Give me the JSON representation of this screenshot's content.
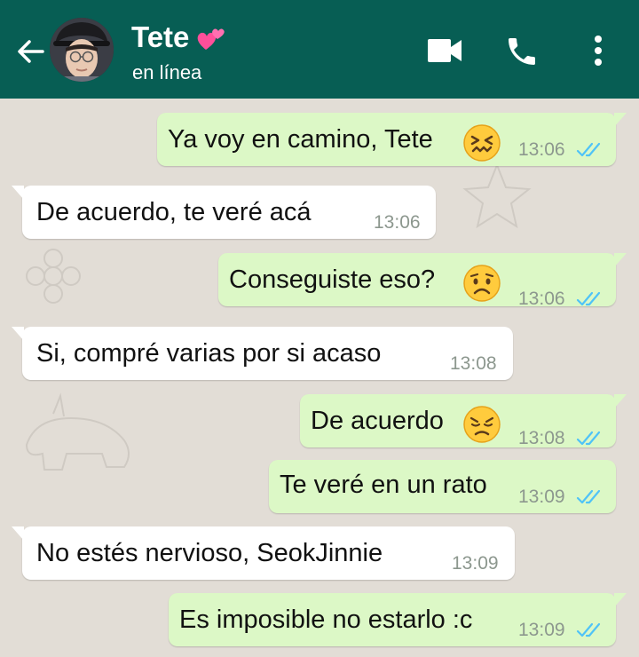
{
  "header": {
    "contact_name": "Tete",
    "status": "en línea"
  },
  "messages": [
    {
      "text": "Ya voy en camino, Tete",
      "time": "13:06"
    },
    {
      "text": "De acuerdo, te veré acá",
      "time": "13:06"
    },
    {
      "text": "Conseguiste eso?",
      "time": "13:06"
    },
    {
      "text": "Si, compré varias por si acaso",
      "time": "13:08"
    },
    {
      "text": "De acuerdo",
      "time": "13:08"
    },
    {
      "text": "Te veré en un rato",
      "time": "13:09"
    },
    {
      "text": "No estés nervioso, SeokJinnie",
      "time": "13:09"
    },
    {
      "text": "Es imposible no estarlo :c",
      "time": "13:09"
    }
  ],
  "colors": {
    "header": "#075e54",
    "outgoing_bubble": "#dcf8c6",
    "incoming_bubble": "#ffffff",
    "read_ticks": "#4fc3f7"
  }
}
